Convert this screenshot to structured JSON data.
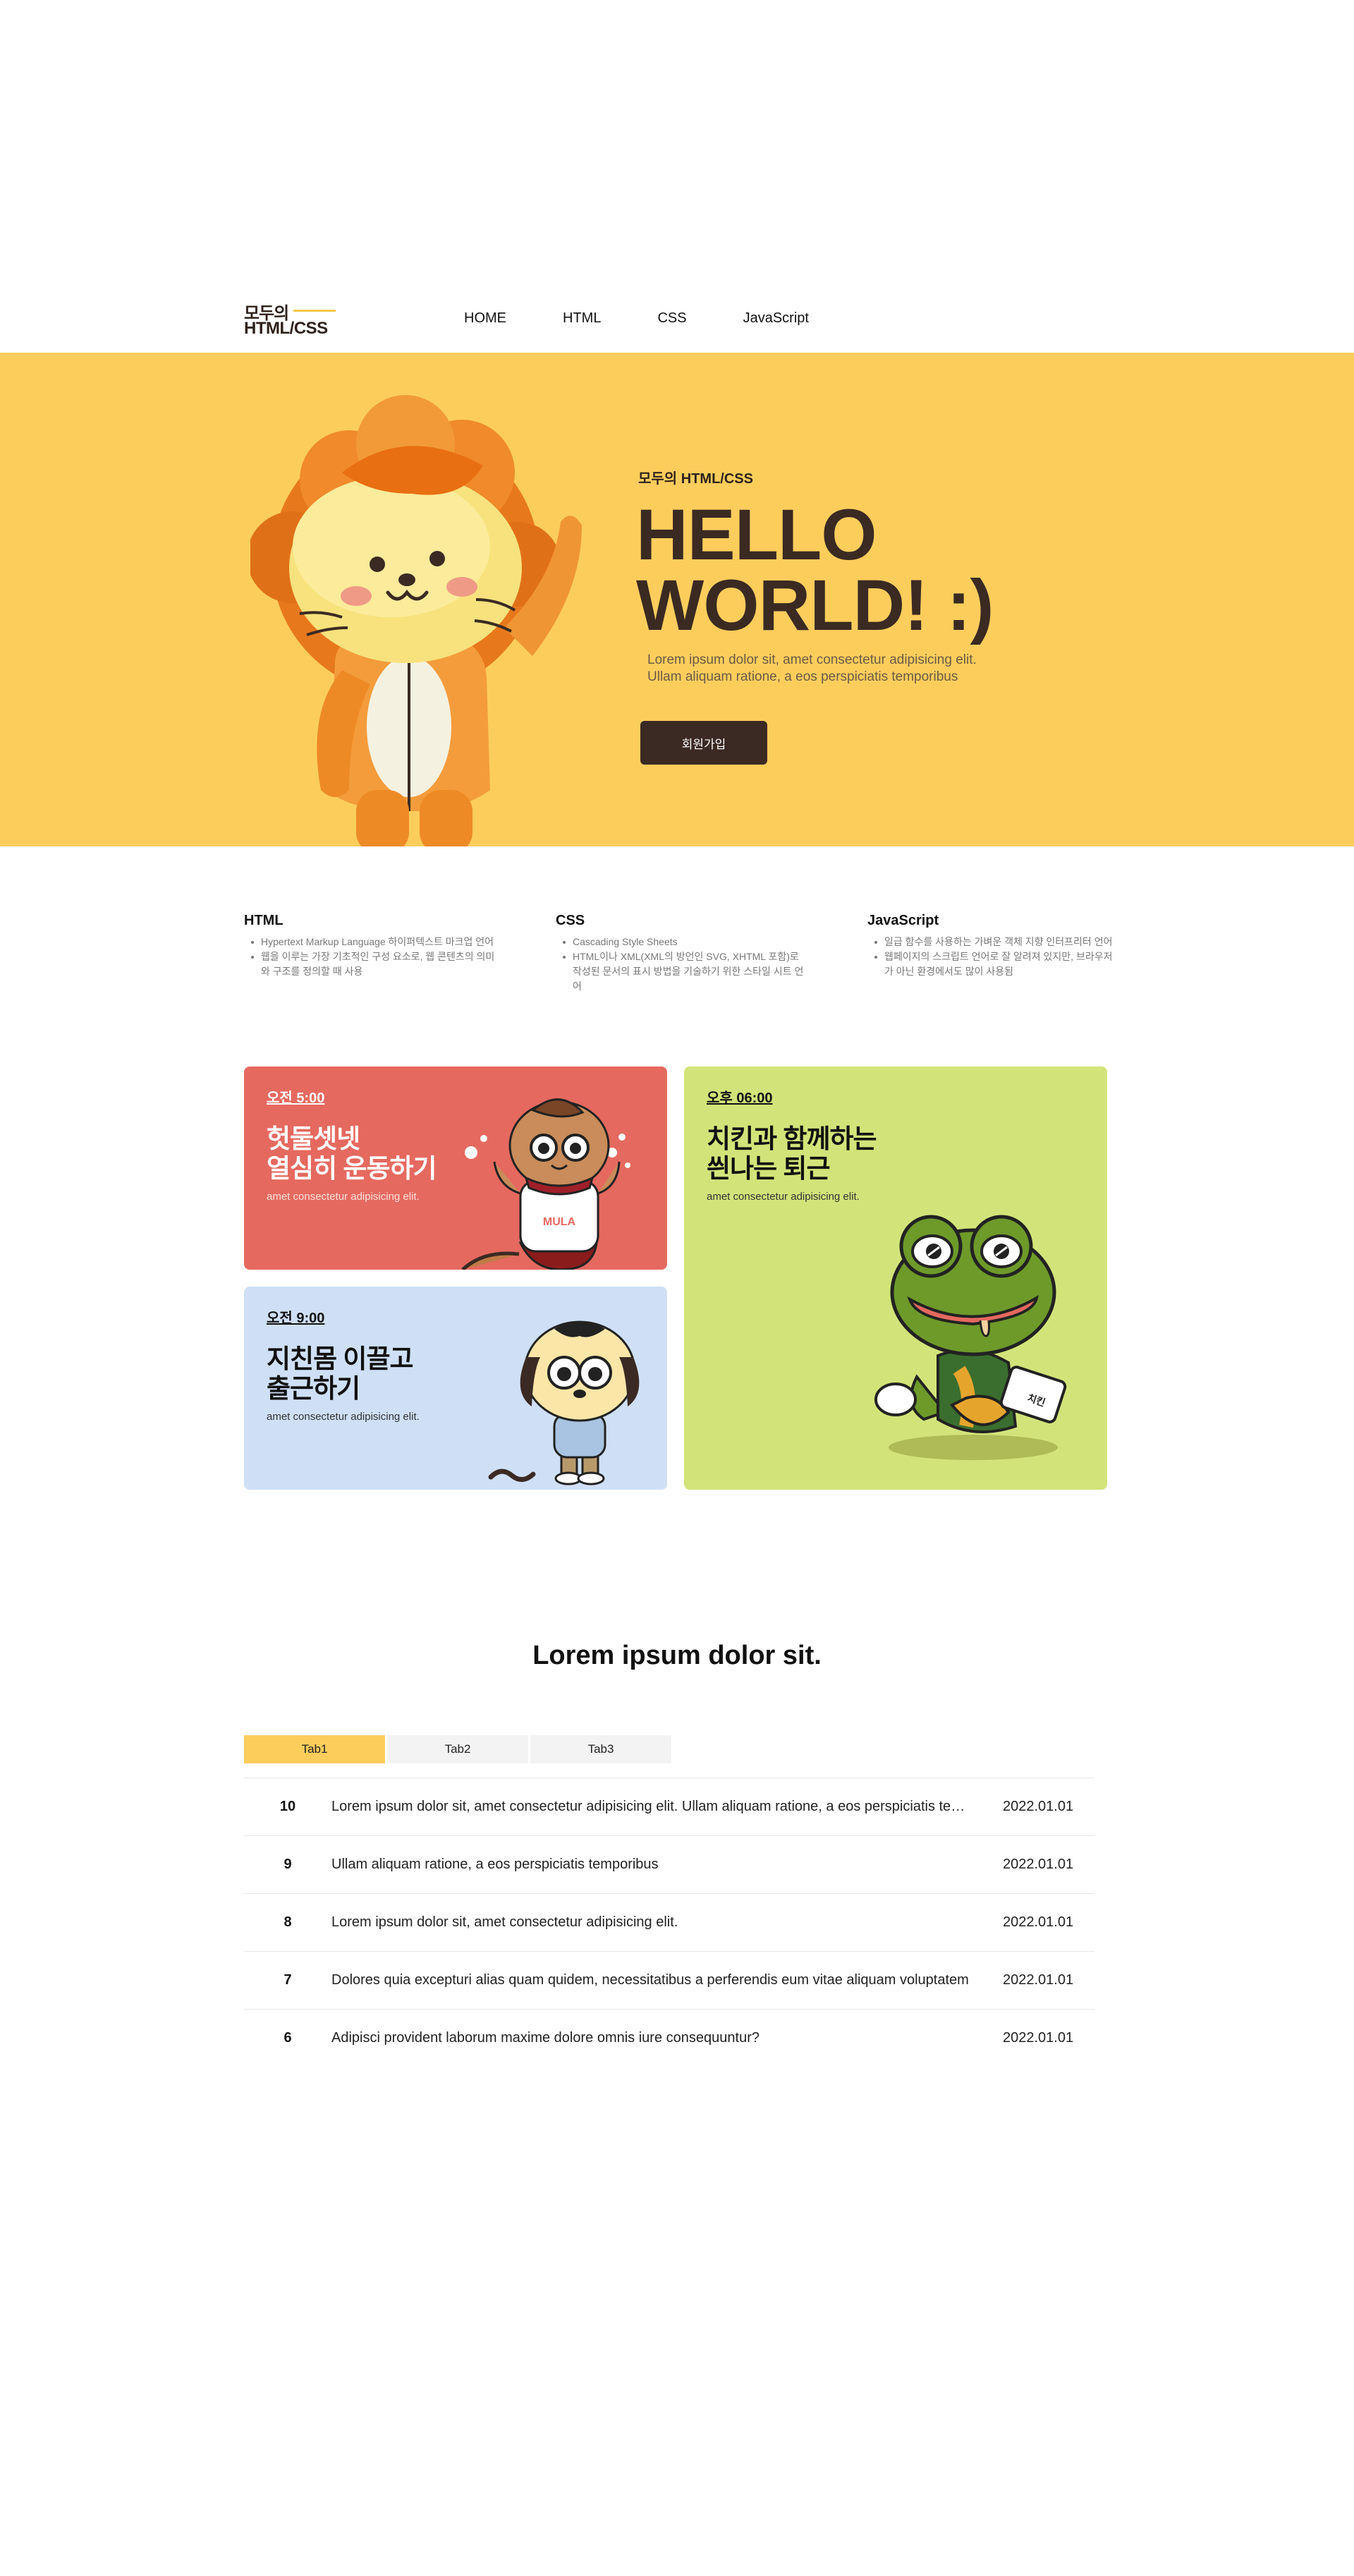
{
  "header": {
    "logo_line1": "모두의",
    "logo_line2": "HTML/CSS",
    "nav": [
      "HOME",
      "HTML",
      "CSS",
      "JavaScript"
    ]
  },
  "hero": {
    "subtitle": "모두의 HTML/CSS",
    "title_line1": "HELLO",
    "title_line2": "WORLD! :)",
    "desc_line1": "Lorem ipsum dolor sit, amet consectetur adipisicing elit.",
    "desc_line2": "Ullam aliquam ratione, a eos perspiciatis temporibus",
    "button": "회원가입"
  },
  "info": [
    {
      "title": "HTML",
      "items": [
        "Hypertext Markup Language 하이퍼텍스트 마크업 언어",
        "웹을 이루는 가장 기초적인 구성 요소로, 웹 콘텐츠의 의미와 구조를 정의할 때 사용"
      ]
    },
    {
      "title": "CSS",
      "items": [
        "Cascading Style Sheets",
        "HTML이나 XML(XML의 방언인 SVG, XHTML 포함)로 작성된 문서의 표시 방법을 기술하기 위한 스타일 시트 언어"
      ]
    },
    {
      "title": "JavaScript",
      "items": [
        "일급 함수를 사용하는 가벼운 객체 지향 인터프리터 언어",
        "웹페이지의 스크립트 언어로 잘 알려져 있지만, 브라우저가 아닌 환경에서도 많이 사용됨"
      ]
    }
  ],
  "cards": {
    "morning5": {
      "time": "오전 5:00",
      "title_line1": "헛둘셋넷",
      "title_line2": "열심히 운동하기",
      "desc": "amet consectetur adipisicing elit.",
      "shirt": "MULA",
      "bg": "#e5695f"
    },
    "morning9": {
      "time": "오전 9:00",
      "title_line1": "지친몸 이끌고",
      "title_line2": "출근하기",
      "desc": "amet consectetur adipisicing elit.",
      "bg": "#cfe0f6"
    },
    "evening6": {
      "time": "오후 06:00",
      "title_line1": "치킨과 함께하는",
      "title_line2": "씐나는 퇴근",
      "desc": "amet consectetur adipisicing elit.",
      "bag": "치킨",
      "bg": "#d2e479"
    }
  },
  "board": {
    "title": "Lorem ipsum dolor sit.",
    "tabs": [
      "Tab1",
      "Tab2",
      "Tab3"
    ],
    "rows": [
      {
        "num": "10",
        "title": "Lorem ipsum dolor sit, amet consectetur adipisicing elit. Ullam aliquam ratione, a eos perspiciatis temporibus",
        "date": "2022.01.01"
      },
      {
        "num": "9",
        "title": "Ullam aliquam ratione, a eos perspiciatis temporibus",
        "date": "2022.01.01"
      },
      {
        "num": "8",
        "title": "Lorem ipsum dolor sit, amet consectetur adipisicing elit.",
        "date": "2022.01.01"
      },
      {
        "num": "7",
        "title": "Dolores quia excepturi alias quam quidem, necessitatibus a perferendis eum vitae aliquam voluptatem",
        "date": "2022.01.01"
      },
      {
        "num": "6",
        "title": "Adipisci provident laborum maxime dolore omnis iure consequuntur?",
        "date": "2022.01.01"
      }
    ]
  },
  "colors": {
    "accent": "#fdcd5c",
    "brown": "#3b2a23"
  }
}
